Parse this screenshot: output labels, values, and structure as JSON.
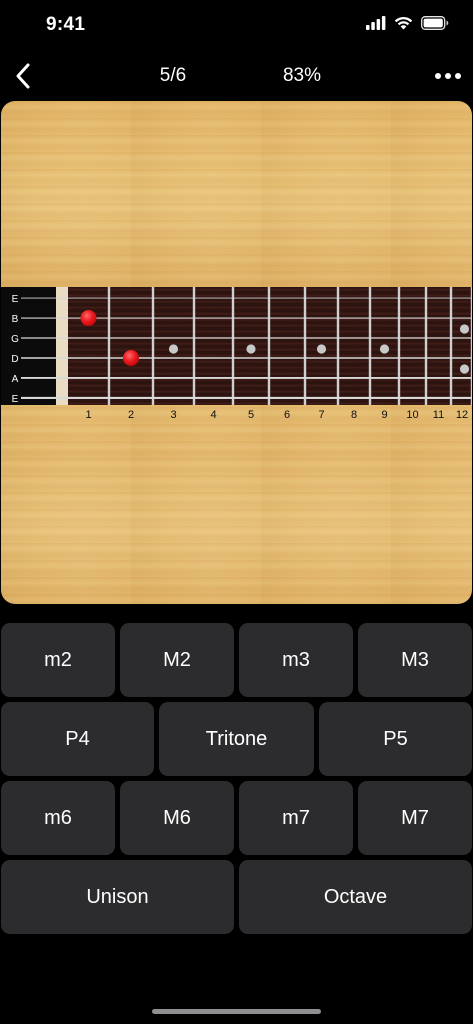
{
  "status_bar": {
    "time": "9:41",
    "icons": [
      "cellular-signal-icon",
      "wifi-icon",
      "battery-icon"
    ]
  },
  "nav": {
    "back_icon": "chevron-left-icon",
    "progress": "5/6",
    "percent": "83%",
    "more_icon": "ellipsis-icon"
  },
  "fretboard": {
    "strings": [
      "E",
      "B",
      "G",
      "D",
      "A",
      "E"
    ],
    "fret_numbers": [
      "1",
      "2",
      "3",
      "4",
      "5",
      "6",
      "7",
      "8",
      "9",
      "10",
      "11",
      "12"
    ],
    "inlay_frets": [
      3,
      5,
      7,
      9
    ],
    "double_inlay_fret": 12,
    "marked_notes": [
      {
        "string": "B",
        "fret": 1
      },
      {
        "string": "D",
        "fret": 2
      }
    ],
    "colors": {
      "wood": "#e3b86d",
      "fretboard": "#3a1a14",
      "nut": "#e8dcc4",
      "note_marker": "#e8141b",
      "inlay": "#c8c8c8"
    }
  },
  "answers": [
    {
      "label": "m2",
      "key": "m2"
    },
    {
      "label": "M2",
      "key": "M2"
    },
    {
      "label": "m3",
      "key": "m3"
    },
    {
      "label": "M3",
      "key": "M3"
    },
    {
      "label": "P4",
      "key": "P4"
    },
    {
      "label": "Tritone",
      "key": "tritone"
    },
    {
      "label": "P5",
      "key": "P5"
    },
    {
      "label": "m6",
      "key": "m6"
    },
    {
      "label": "M6",
      "key": "M6"
    },
    {
      "label": "m7",
      "key": "m7"
    },
    {
      "label": "M7",
      "key": "M7"
    },
    {
      "label": "Unison",
      "key": "unison"
    },
    {
      "label": "Octave",
      "key": "octave"
    }
  ],
  "colors": {
    "background": "#000000",
    "button": "#2c2c2e",
    "text": "#ffffff"
  }
}
